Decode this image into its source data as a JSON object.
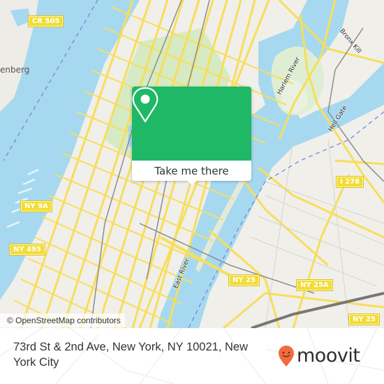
{
  "map": {
    "colors": {
      "land": "#f1efea",
      "water": "#a6d9ef",
      "park": "#d6ebc4",
      "road_major": "#f7de5a",
      "road_casing": "#e6c94a",
      "rail": "#8c8c8c",
      "boundary": "#6f7fe0"
    },
    "road_shields": [
      {
        "id": "cr505",
        "label": "CR 505"
      },
      {
        "id": "ny9a",
        "label": "NY 9A"
      },
      {
        "id": "ny495",
        "label": "NY 495"
      },
      {
        "id": "i278",
        "label": "I 278"
      },
      {
        "id": "ny25-a",
        "label": "NY 25"
      },
      {
        "id": "ny25a",
        "label": "NY 25A"
      },
      {
        "id": "ny25-b",
        "label": "NY 25"
      }
    ],
    "water_labels": [
      {
        "id": "harlem",
        "label": "Harlem River"
      },
      {
        "id": "bronxkill",
        "label": "Bronx Kill"
      },
      {
        "id": "hellgate",
        "label": "Hell Gate"
      },
      {
        "id": "eastriver",
        "label": "East River"
      }
    ],
    "place_labels": [
      {
        "id": "guttenberg",
        "label": "enberg"
      }
    ],
    "attribution": "© OpenStreetMap contributors"
  },
  "popup": {
    "icon": "map-pin-icon",
    "button_label": "Take me there",
    "accent_color": "#1fb866"
  },
  "footer": {
    "address": "73rd St & 2nd Ave, New York, NY 10021, New York City",
    "brand": {
      "name": "moovit",
      "icon": "moovit-pin-logo-icon",
      "logo_color": "#f26b3a"
    }
  }
}
